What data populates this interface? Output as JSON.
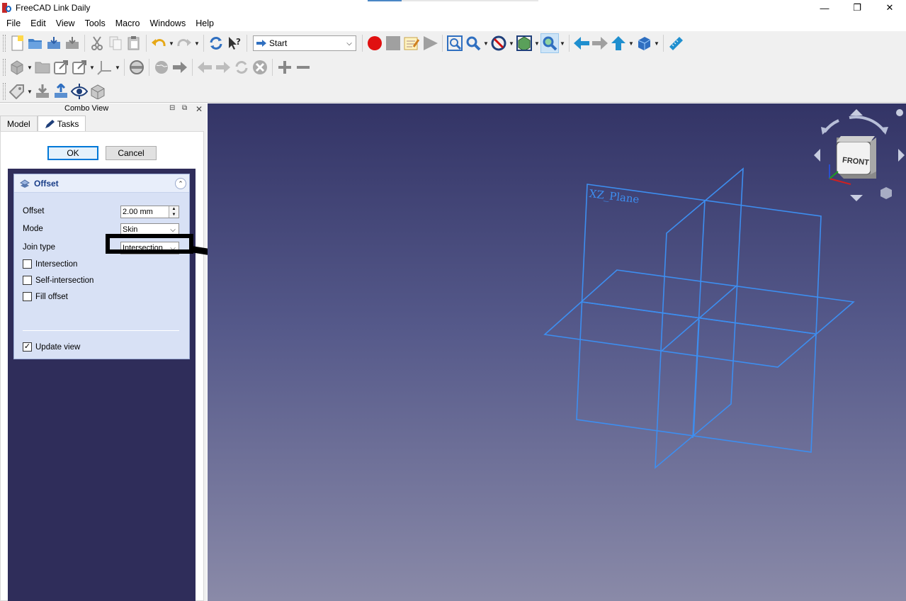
{
  "window": {
    "title": "FreeCAD Link Daily",
    "controls": {
      "minimize": "—",
      "maximize": "❐",
      "close": "✕"
    }
  },
  "menu": [
    "File",
    "Edit",
    "View",
    "Tools",
    "Macro",
    "Windows",
    "Help"
  ],
  "toolbar": {
    "workbench": "Start"
  },
  "combo": {
    "title": "Combo View",
    "tabs": {
      "model": "Model",
      "tasks": "Tasks"
    },
    "ok": "OK",
    "cancel": "Cancel"
  },
  "offset": {
    "title": "Offset",
    "fields": {
      "offset_label": "Offset",
      "offset_value": "2.00 mm",
      "mode_label": "Mode",
      "mode_value": "Skin",
      "join_label": "Join type",
      "join_value": "Intersection"
    },
    "checks": {
      "intersection": "Intersection",
      "self_intersection": "Self-intersection",
      "fill_offset": "Fill offset",
      "update_view": "Update view"
    },
    "checked": {
      "intersection": false,
      "self_intersection": false,
      "fill_offset": false,
      "update_view": true
    }
  },
  "view": {
    "plane_label": "XZ_Plane",
    "navcube_face": "FRONT",
    "plane_color": "#3d8ef0",
    "background_top": "#333466",
    "background_bottom": "#8a8aa8"
  }
}
